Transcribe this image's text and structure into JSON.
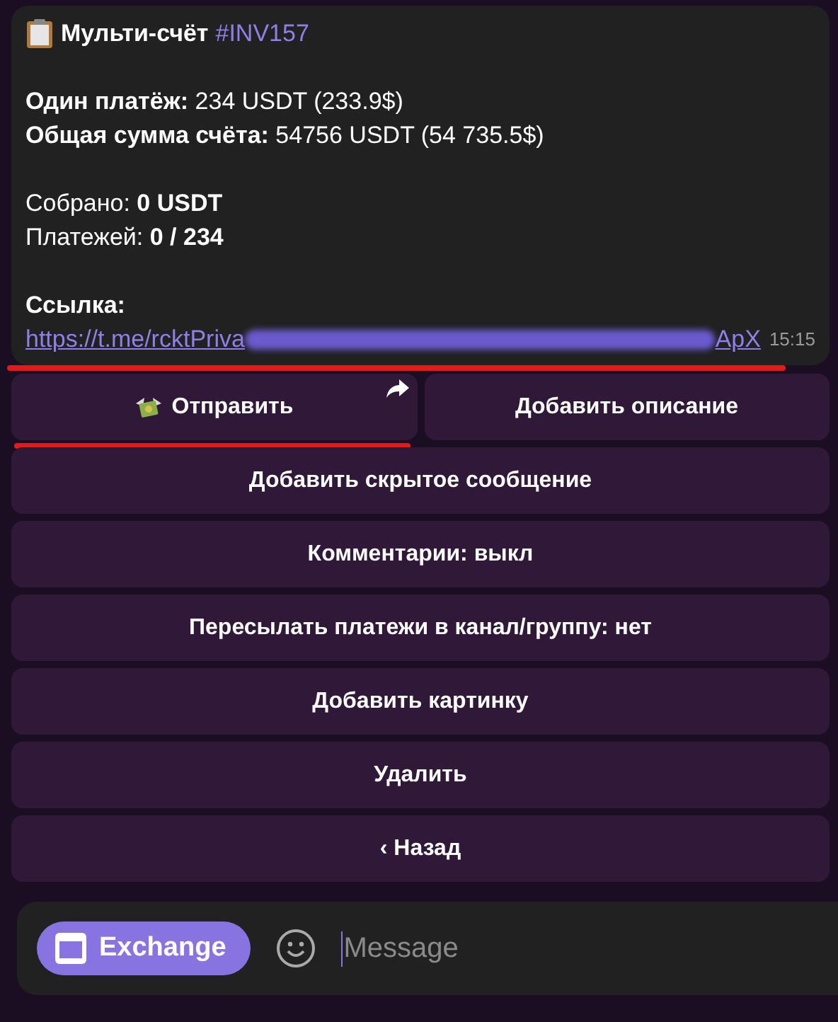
{
  "message": {
    "title": "Мульти-счёт",
    "tag": "#INV157",
    "paragraphs": [
      [
        "**Один платёж:** 234 USDT (233.9$)",
        "**Общая сумма счёта:** 54756 USDT (54 735.5$)"
      ],
      [
        "Собрано: **0 USDT**",
        "Платежей: **0 / 234**"
      ],
      [
        "**Ссылка:**"
      ]
    ],
    "link": {
      "start": "https://t.me/rcktPriva",
      "end": "ApX"
    },
    "time": "15:15"
  },
  "keyboard": [
    [
      {
        "label": "Отправить",
        "kind": "share"
      },
      {
        "label": "Добавить описание",
        "kind": "callback"
      }
    ],
    [
      {
        "label": "Добавить скрытое сообщение",
        "kind": "callback"
      }
    ],
    [
      {
        "label": "Комментарии: выкл",
        "kind": "callback"
      }
    ],
    [
      {
        "label": "Пересылать платежи в канал/группу: нет",
        "kind": "callback"
      }
    ],
    [
      {
        "label": "Добавить картинку",
        "kind": "callback"
      }
    ],
    [
      {
        "label": "Удалить",
        "kind": "callback"
      }
    ],
    [
      {
        "label": "‹ Назад",
        "kind": "callback"
      }
    ]
  ],
  "input": {
    "button": "Exchange",
    "placeholder": "Message"
  }
}
